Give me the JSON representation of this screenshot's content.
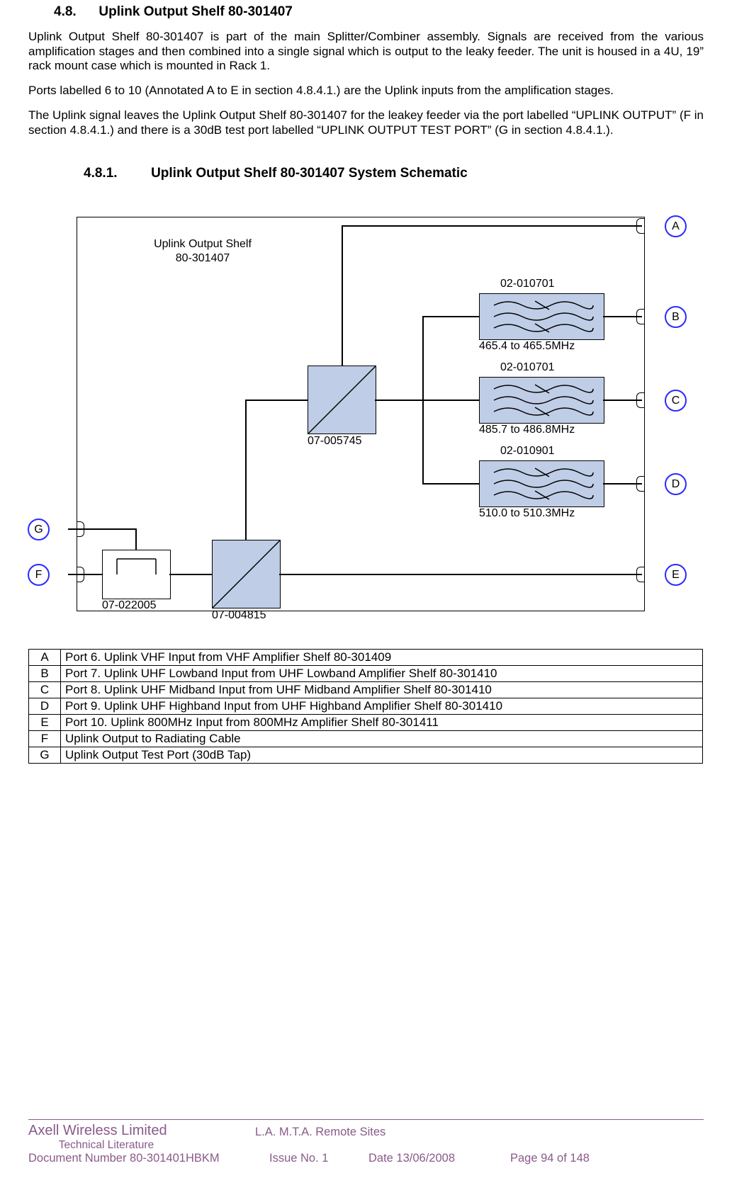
{
  "section48": {
    "num": "4.8.",
    "title": "Uplink Output Shelf 80-301407"
  },
  "para1": "Uplink Output Shelf 80-301407 is part of the main Splitter/Combiner assembly. Signals are received from the various amplification stages and then combined into a single signal which is output to the leaky feeder. The unit is housed in a 4U, 19” rack mount case which is mounted in Rack 1.",
  "para2": "Ports labelled 6 to 10 (Annotated A to E in section 4.8.4.1.) are the Uplink inputs from the amplification stages.",
  "para3": "The Uplink signal leaves the Uplink Output Shelf 80-301407 for the leakey feeder via the port labelled “UPLINK OUTPUT” (F in section 4.8.4.1.) and there is a 30dB test port labelled “UPLINK OUTPUT TEST PORT” (G in section 4.8.4.1.).",
  "section481": {
    "num": "4.8.1.",
    "title": "Uplink Output Shelf 80-301407 System Schematic"
  },
  "diagram": {
    "title_l1": "Uplink Output Shelf",
    "title_l2": "80-301407",
    "portA": "A",
    "portB": "B",
    "portC": "C",
    "portD": "D",
    "portE": "E",
    "portF": "F",
    "portG": "G",
    "filter1_top": "02-010701",
    "filter1_bot": "465.4 to 465.5MHz",
    "filter2_top": "02-010701",
    "filter2_bot": "485.7 to 486.8MHz",
    "filter3_top": "02-010901",
    "filter3_bot": "510.0 to 510.3MHz",
    "splitter1": "07-005745",
    "splitter2": "07-004815",
    "coupler": "07-022005"
  },
  "table": [
    {
      "k": "A",
      "v": "Port 6. Uplink VHF Input from VHF Amplifier Shelf 80-301409"
    },
    {
      "k": "B",
      "v": "Port 7. Uplink UHF Lowband Input from UHF Lowband Amplifier Shelf 80-301410"
    },
    {
      "k": "C",
      "v": "Port 8. Uplink UHF Midband Input from UHF Midband Amplifier Shelf 80-301410"
    },
    {
      "k": "D",
      "v": "Port 9. Uplink UHF Highband Input from UHF Highband Amplifier Shelf 80-301410"
    },
    {
      "k": "E",
      "v": "Port 10. Uplink 800MHz Input from 800MHz Amplifier Shelf 80-301411"
    },
    {
      "k": "F",
      "v": "Uplink Output to Radiating Cable"
    },
    {
      "k": "G",
      "v": "Uplink Output Test Port (30dB Tap)"
    }
  ],
  "footer": {
    "brand": "Axell Wireless Limited",
    "sub": "Technical Literature",
    "center": "L.A. M.T.A. Remote Sites",
    "docnum": "Document Number 80-301401HBKM",
    "issue": "Issue No. 1",
    "date": "Date 13/06/2008",
    "page": "Page 94 of 148"
  }
}
